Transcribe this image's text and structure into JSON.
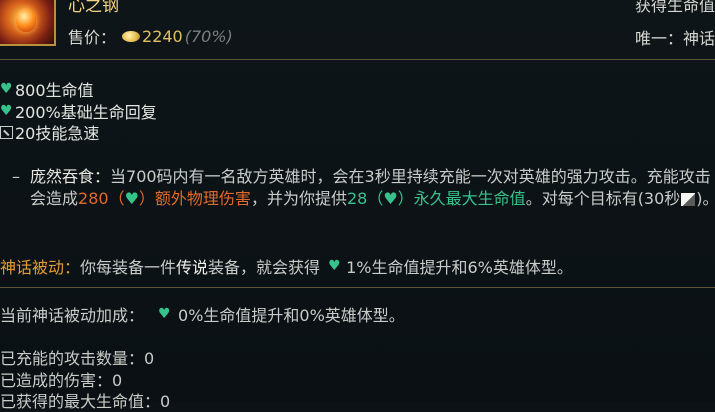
{
  "item": {
    "name": "心之钢",
    "price_label": "售价：",
    "price": "2240",
    "price_pct": "(70%)",
    "header_right_1": "获得生命值",
    "header_right_2": "唯一：神话"
  },
  "stats": [
    {
      "icon": "heart-icon",
      "text": "800生命值"
    },
    {
      "icon": "heart-icon",
      "text": "200%基础生命回复"
    },
    {
      "icon": "ability-haste-icon",
      "text": "20技能急速"
    }
  ],
  "passive": {
    "dash": "–",
    "name": "庞然吞食：",
    "text_1": "当700码内有一名敌方英雄时，会在3秒里持续充能一次对英雄的强力攻击。充能攻击会造成",
    "damage_value": "280",
    "damage_open": "（",
    "damage_close": "）额外物理伤害",
    "text_2": "，并为你提供",
    "hp_value": "28",
    "hp_open": "（",
    "hp_close": "）永久最大生命值",
    "text_3": "。对每个目标有(30秒",
    "text_4": ")。"
  },
  "mythic": {
    "label": "神话被动：",
    "text_1": "你每装备一件",
    "legend": "传说",
    "text_2": "装备，就会获得",
    "text_3": "1%生命值提升和6%英雄体型。"
  },
  "info": {
    "bonus_label": "当前神话被动加成：",
    "bonus_value": "0%生命值提升和0%英雄体型。",
    "charged_attacks": "已充能的攻击数量：0",
    "damage_dealt": "已造成的伤害：0",
    "max_hp_gained": "已获得的最大生命值：0"
  },
  "colors": {
    "gold": "#f1d282",
    "heart_green": "#36c38b",
    "damage_orange": "#e06a2a",
    "mythic_orange": "#e39b36",
    "divider": "#5e5635"
  }
}
